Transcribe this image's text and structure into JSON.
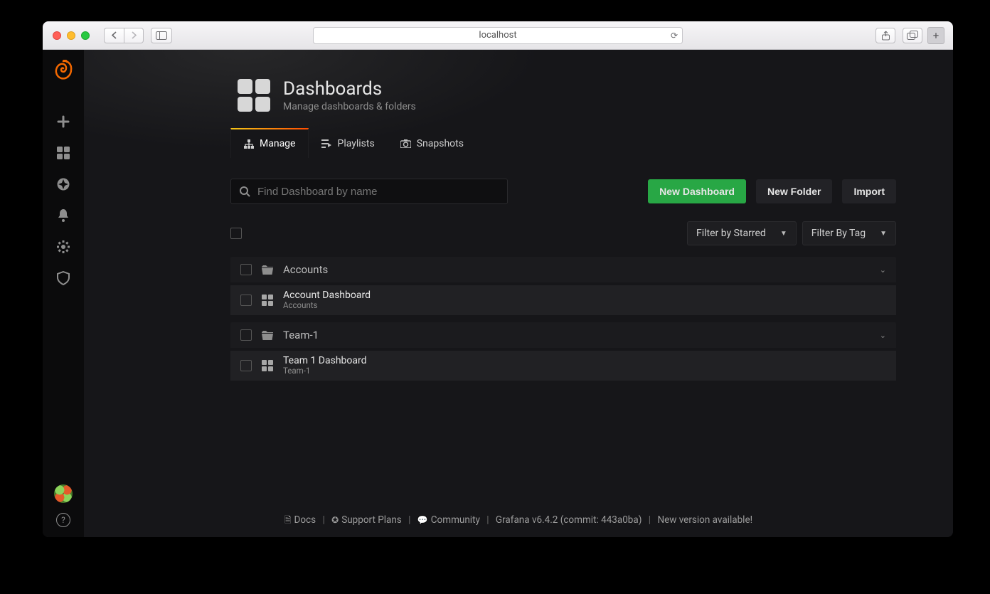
{
  "browser": {
    "url": "localhost"
  },
  "page": {
    "title": "Dashboards",
    "subtitle": "Manage dashboards & folders"
  },
  "tabs": {
    "manage": "Manage",
    "playlists": "Playlists",
    "snapshots": "Snapshots"
  },
  "toolbar": {
    "search_placeholder": "Find Dashboard by name",
    "new_dashboard": "New Dashboard",
    "new_folder": "New Folder",
    "import": "Import"
  },
  "filters": {
    "starred": "Filter by Starred",
    "tag": "Filter By Tag"
  },
  "folders": [
    {
      "name": "Accounts",
      "items": [
        {
          "title": "Account Dashboard",
          "sub": "Accounts"
        }
      ]
    },
    {
      "name": "Team-1",
      "items": [
        {
          "title": "Team 1 Dashboard",
          "sub": "Team-1"
        }
      ]
    }
  ],
  "footer": {
    "docs": "Docs",
    "support": "Support Plans",
    "community": "Community",
    "version": "Grafana v6.4.2 (commit: 443a0ba)",
    "update": "New version available!"
  }
}
